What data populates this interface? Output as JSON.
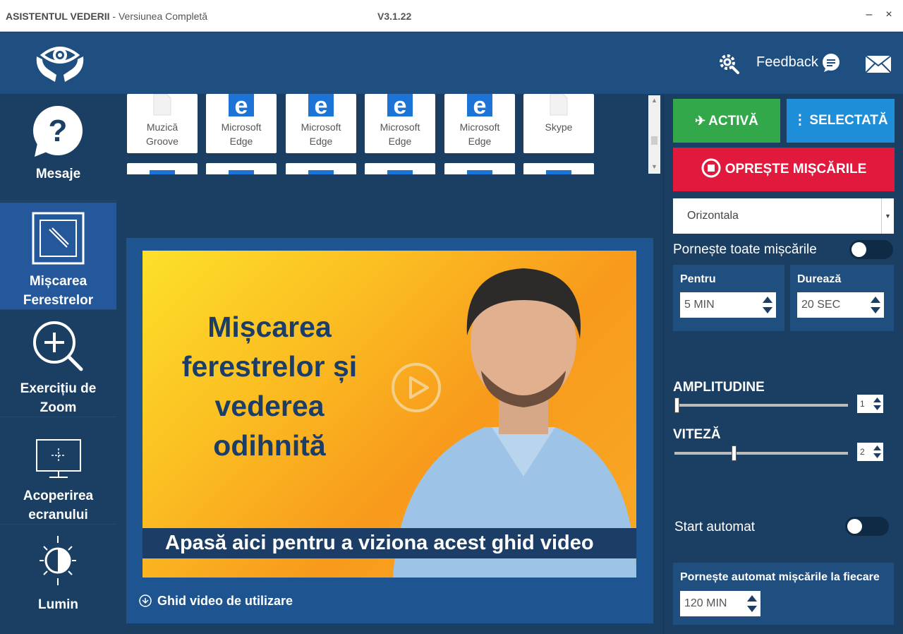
{
  "window": {
    "title": "ASISTENTUL VEDERII",
    "subtitle": " - Versiunea Completă",
    "version": "V3.1.22",
    "minimize": "–",
    "close": "×"
  },
  "header": {
    "feedback": "Feedback"
  },
  "sidebar": {
    "items": [
      {
        "label": "Mesaje"
      },
      {
        "label1": "Mișcarea",
        "label2": "Ferestrelor"
      },
      {
        "label1": "Exercițiu de",
        "label2": "Zoom"
      },
      {
        "label1": "Acoperirea",
        "label2": "ecranului"
      },
      {
        "label": "Lumin"
      }
    ]
  },
  "apps": [
    {
      "line1": "Muzică",
      "line2": "Groove",
      "icon": "file-icon"
    },
    {
      "line1": "Microsoft",
      "line2": "Edge",
      "icon": "edge-icon"
    },
    {
      "line1": "Microsoft",
      "line2": "Edge",
      "icon": "edge-icon"
    },
    {
      "line1": "Microsoft",
      "line2": "Edge",
      "icon": "edge-icon"
    },
    {
      "line1": "Microsoft",
      "line2": "Edge",
      "icon": "edge-icon"
    },
    {
      "line1": "Skype",
      "line2": "",
      "icon": "file-icon"
    }
  ],
  "video": {
    "headline1": "Mișcarea",
    "headline2": "ferestrelor și",
    "headline3": "vederea",
    "headline4": "odihnită",
    "caption": "Apasă aici pentru a viziona acest ghid video",
    "guide": "Ghid video de utilizare"
  },
  "controls": {
    "active_btn": "ACTIVĂ",
    "selected_btn": "SELECTATĂ",
    "stop_btn": "OPREȘTE MIȘCĂRILE",
    "direction_value": "Orizontala",
    "start_all_label": "Pornește toate mișcările",
    "start_all_on": false,
    "for_label": "Pentru",
    "for_value": "5 MIN",
    "duration_label": "Durează",
    "duration_value": "20 SEC",
    "amplitude_label": "AMPLITUDINE",
    "amplitude_value": "1",
    "amplitude_fraction": 0.0,
    "speed_label": "VITEZĂ",
    "speed_value": "2",
    "speed_fraction": 0.34,
    "autostart_label": "Start automat",
    "autostart_on": false,
    "auto_every_label": "Pornește automat mișcările la fiecare",
    "auto_every_value": "120 MIN"
  },
  "colors": {
    "active": "#32a84a",
    "selected": "#1f8ed8",
    "stop": "#e1193d",
    "sidebar_active": "#25589a"
  }
}
